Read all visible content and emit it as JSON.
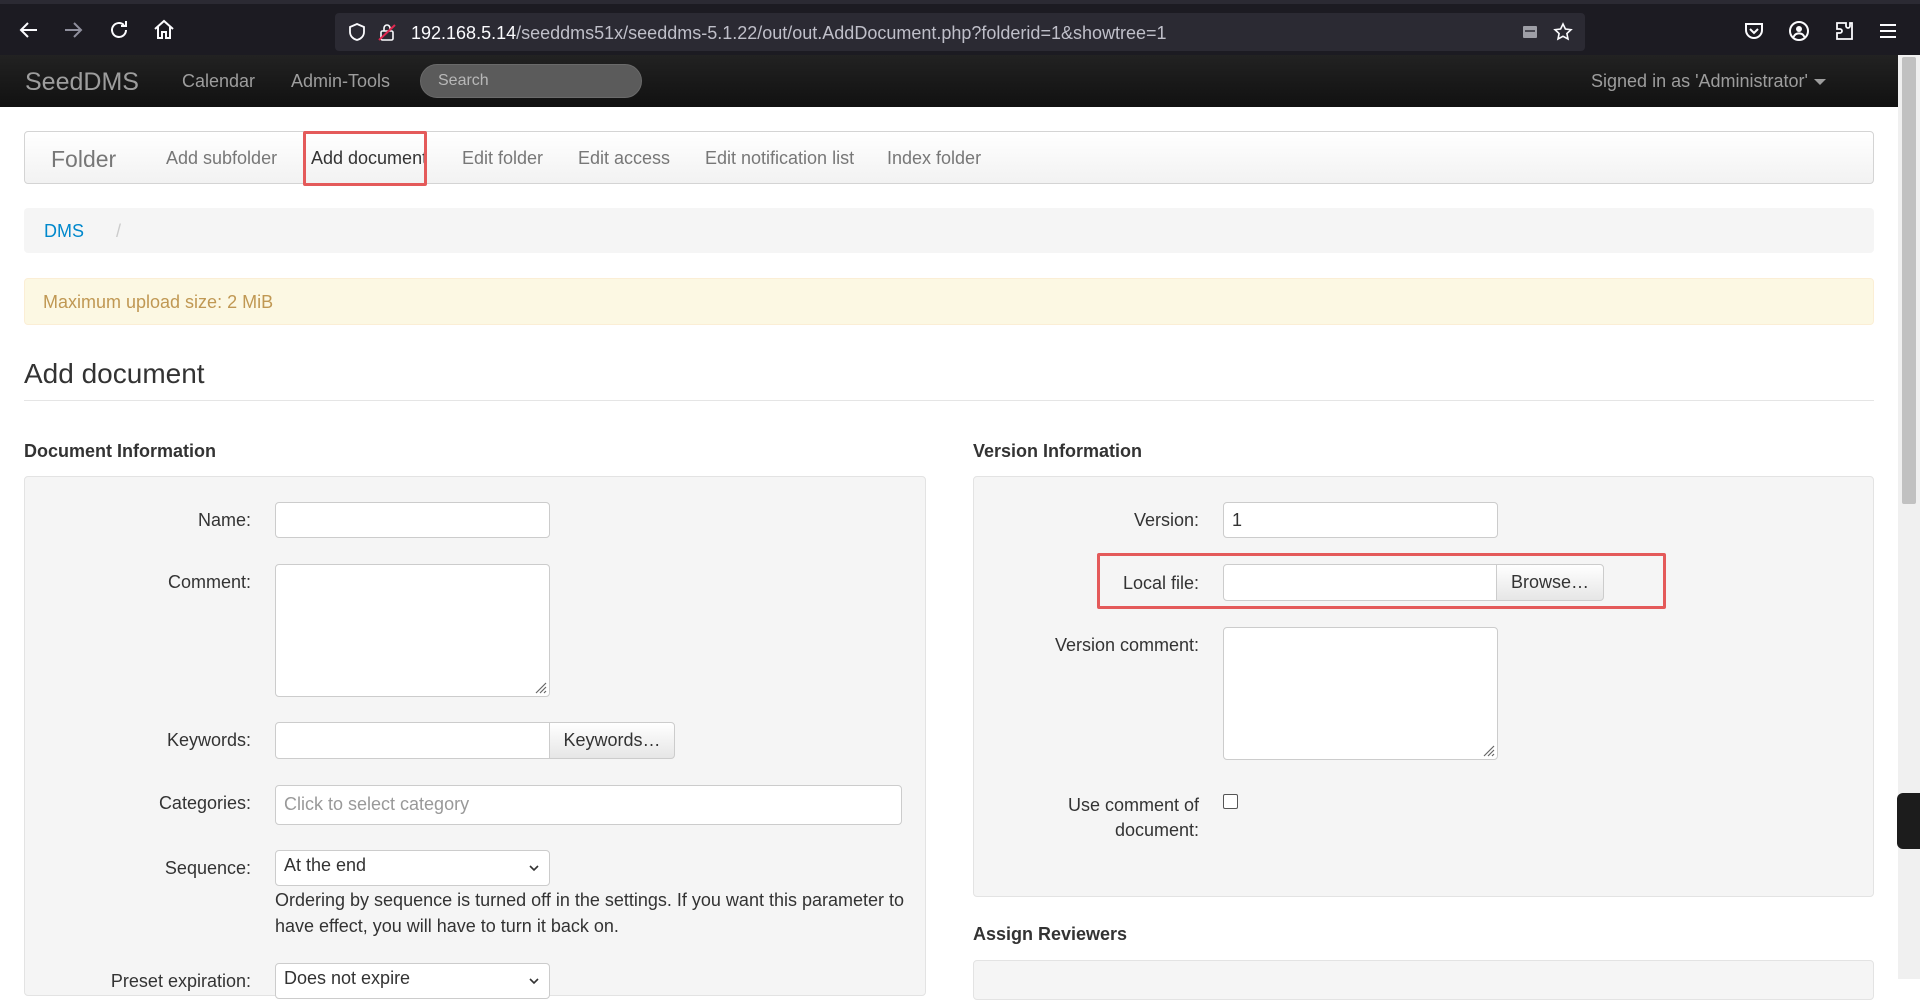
{
  "browser": {
    "url_host": "192.168.5.14",
    "url_path": "/seeddms51x/seeddms-5.1.22/out/out.AddDocument.php?folderid=1&showtree=1"
  },
  "app_nav": {
    "brand": "SeedDMS",
    "links": [
      "Calendar",
      "Admin-Tools"
    ],
    "search_placeholder": "Search",
    "signed_in": "Signed in as 'Administrator'"
  },
  "folder_nav": {
    "title": "Folder",
    "items": [
      "Add subfolder",
      "Add document",
      "Edit folder",
      "Edit access",
      "Edit notification list",
      "Index folder"
    ],
    "active": "Add document"
  },
  "breadcrumb": {
    "root": "DMS",
    "separator": "/"
  },
  "alert": {
    "text": "Maximum upload size: 2 MiB"
  },
  "page_title": "Add document",
  "document_info": {
    "legend": "Document Information",
    "name_label": "Name:",
    "name_value": "",
    "comment_label": "Comment:",
    "keywords_label": "Keywords:",
    "keywords_button": "Keywords…",
    "categories_label": "Categories:",
    "categories_placeholder": "Click to select category",
    "sequence_label": "Sequence:",
    "sequence_value": "At the end",
    "sequence_help_line1": "Ordering by sequence is turned off in the settings. If you want this parameter to",
    "sequence_help_line2": "have effect, you will have to turn it back on.",
    "expiration_label": "Preset expiration:",
    "expiration_value": "Does not expire"
  },
  "version_info": {
    "legend": "Version Information",
    "version_label": "Version:",
    "version_value": "1",
    "local_file_label": "Local file:",
    "browse_button": "Browse…",
    "version_comment_label": "Version comment:",
    "use_comment_label_line1": "Use comment of",
    "use_comment_label_line2": "document:",
    "use_comment_checked": false
  },
  "reviewers": {
    "legend": "Assign Reviewers"
  }
}
